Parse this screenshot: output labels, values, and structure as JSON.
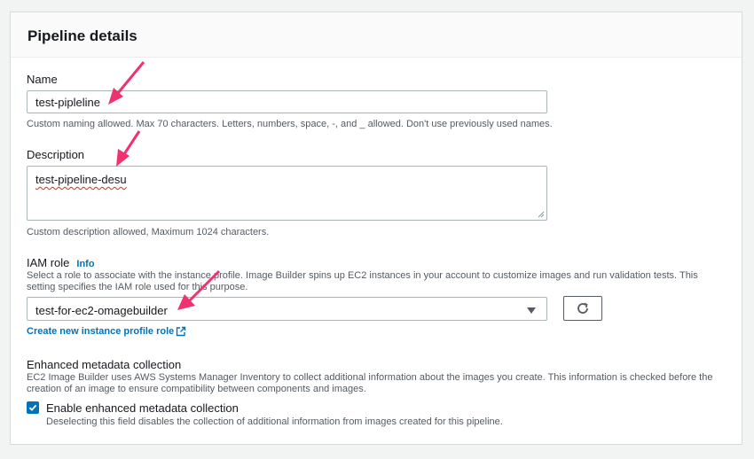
{
  "panel": {
    "title": "Pipeline details"
  },
  "name": {
    "label": "Name",
    "value": "test-pipleline",
    "hint": "Custom naming allowed. Max 70 characters. Letters, numbers, space, -, and _ allowed. Don't use previously used names."
  },
  "description": {
    "label": "Description",
    "value": "test-pipeline-desu",
    "hint": "Custom description allowed, Maximum 1024 characters."
  },
  "iam_role": {
    "label": "IAM role",
    "info": "Info",
    "hint_line1": "Select a role to associate with the instance profile. Image Builder spins up EC2 instances in your account to customize images and run validation tests. This",
    "hint_line2": "setting specifies the IAM role used for this purpose.",
    "selected": "test-for-ec2-omagebuilder",
    "create_link": "Create new instance profile role",
    "icons": {
      "dropdown": "caret-down-icon",
      "refresh": "refresh-icon",
      "external": "external-link-icon"
    }
  },
  "metadata": {
    "label": "Enhanced metadata collection",
    "hint_line1": "EC2 Image Builder uses AWS Systems Manager Inventory to collect additional information about the images you create. This information is checked before the",
    "hint_line2": "creation of an image to ensure compatibility between components and images.",
    "checkbox_label": "Enable enhanced metadata collection",
    "checkbox_checked": true,
    "checkbox_hint": "Deselecting this field disables the collection of additional information from images created for this pipeline."
  },
  "colors": {
    "accent": "#0073bb",
    "annotation": "#f0326f",
    "border": "#aab7b8"
  }
}
